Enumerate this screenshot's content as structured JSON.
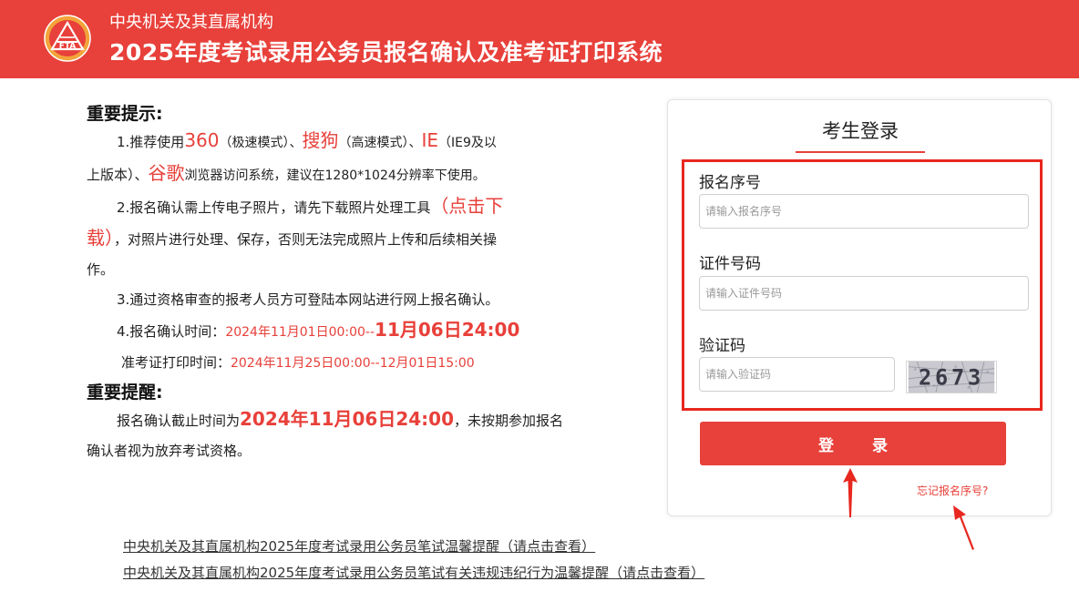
{
  "header": {
    "subtitle": "中央机关及其直属机构",
    "title": "2025年度考试录用公务员报名确认及准考证打印系统",
    "bg_color": "#e8403a",
    "logo_icon": "fta-logo-icon"
  },
  "notice": {
    "heading": "重要提示:",
    "tip1": {
      "pre": "1.推荐使用",
      "b360": "360",
      "m360": "（极速模式）、",
      "sogou": "搜狗",
      "msogou": "（高速模式）、",
      "ie": "IE",
      "mie": "（IE9及以",
      "line2": "上版本）、",
      "chrome": "谷歌",
      "post": "浏览器访问系统，建议在1280*1024分辨率下使用。"
    },
    "tip2": {
      "pre": "2.报名确认需上传电子照片，请先下载照片处理工具",
      "link1": "（点击下",
      "link2": "载）",
      "post1": "，对照片进行处理、保存，否则无法完成照片上传和后续相关操",
      "post2": "作。"
    },
    "tip3": "3.通过资格审查的报考人员方可登陆本网站进行网上报名确认。",
    "tip4": {
      "label": "4.报名确认时间：",
      "start": "2024年11月01日00:00--",
      "end": "11月06日24:00"
    },
    "print": {
      "label": "准考证打印时间：",
      "time": "2024年11月25日00:00--12月01日15:00"
    },
    "reminder_heading": "重要提醒:",
    "reminder": {
      "pre": "报名确认截止时间为",
      "deadline": "2024年11月06日24:00",
      "post1": "，未按期参加报名",
      "post2": "确认者视为放弃考试资格。"
    }
  },
  "links": [
    "中央机关及其直属机构2025年度考试录用公务员笔试温馨提醒（请点击查看）",
    "中央机关及其直属机构2025年度考试录用公务员笔试有关违规违纪行为温馨提醒（请点击查看）"
  ],
  "login": {
    "title": "考生登录",
    "reg_label": "报名序号",
    "reg_placeholder": "请输入报名序号",
    "id_label": "证件号码",
    "id_placeholder": "请输入证件号码",
    "captcha_label": "验证码",
    "captcha_placeholder": "请输入验证码",
    "captcha_text": "2673",
    "submit": "登 录",
    "forgot": "忘记报名序号?"
  }
}
